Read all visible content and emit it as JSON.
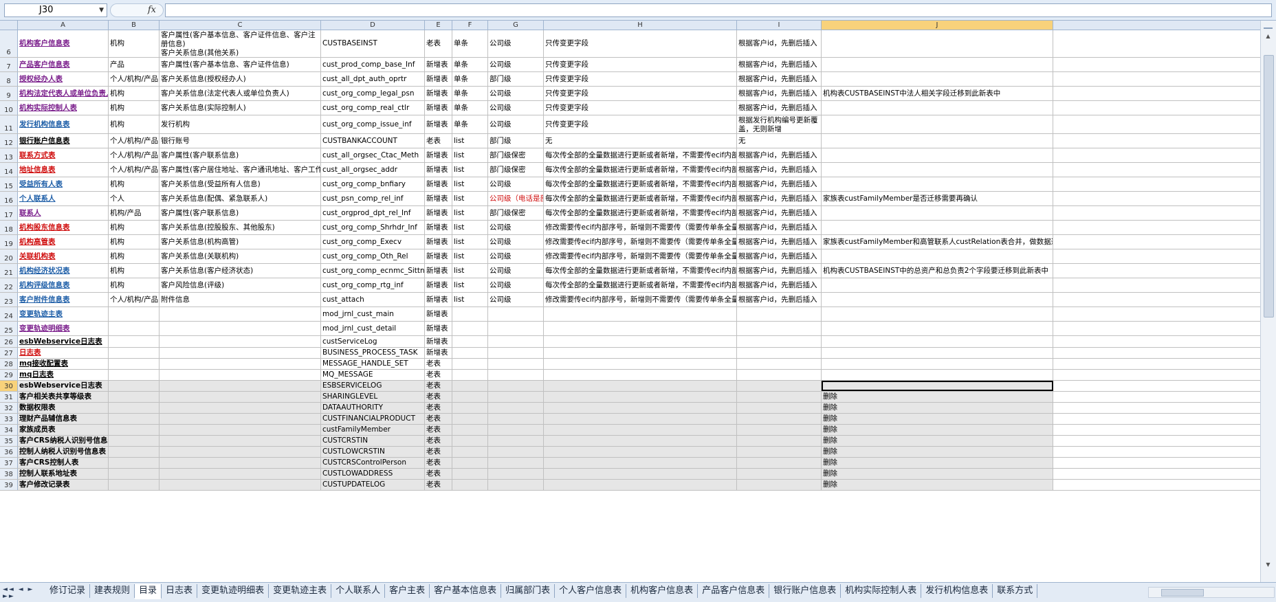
{
  "formula_bar": {
    "name_box": "J30",
    "fx": "fx",
    "formula": ""
  },
  "columns": [
    "A",
    "B",
    "C",
    "D",
    "E",
    "F",
    "G",
    "H",
    "I",
    "J"
  ],
  "selected_column": "J",
  "selected_row": "30",
  "rows": [
    {
      "n": "6",
      "a": "机构客户信息表",
      "as": "purple",
      "b": "机构",
      "c": "客户属性(客户基本信息、客户证件信息、客户注册信息)\n客户关系信息(其他关系)\n客户管理信息（客户标识信息）",
      "d": "CUSTBASEINST",
      "e": "老表",
      "f": "单条",
      "g": "公司级",
      "h": "只传变更字段",
      "i": "根据客户id，先删后插入",
      "j": ""
    },
    {
      "n": "7",
      "a": "产品客户信息表",
      "as": "purple",
      "b": "产品",
      "c": "客户属性(客户基本信息、客户证件信息)",
      "d": "cust_prod_comp_base_Inf",
      "e": "新增表",
      "f": "单条",
      "g": "公司级",
      "h": "只传变更字段",
      "i": "根据客户id，先删后插入",
      "j": ""
    },
    {
      "n": "8",
      "a": "授权经办人表",
      "as": "purple",
      "b": "个人/机构/产品",
      "c": "客户关系信息(授权经办人)",
      "d": "cust_all_dpt_auth_oprtr",
      "e": "新增表",
      "f": "单条",
      "g": "部门级",
      "h": "只传变更字段",
      "i": "根据客户id，先删后插入",
      "j": ""
    },
    {
      "n": "9",
      "a": "机构法定代表人或单位负责人表",
      "as": "purple",
      "b": "机构",
      "c": "客户关系信息(法定代表人或单位负责人)",
      "d": "cust_org_comp_legal_psn",
      "e": "新增表",
      "f": "单条",
      "g": "公司级",
      "h": "只传变更字段",
      "i": "根据客户id，先删后插入",
      "j": "机构表CUSTBASEINST中法人相关字段迁移到此新表中"
    },
    {
      "n": "10",
      "a": "机构实际控制人表",
      "as": "purple",
      "b": "机构",
      "c": "客户关系信息(实际控制人)",
      "d": "cust_org_comp_real_ctlr",
      "e": "新增表",
      "f": "单条",
      "g": "公司级",
      "h": "只传变更字段",
      "i": "根据客户id，先删后插入",
      "j": ""
    },
    {
      "n": "11",
      "a": "发行机构信息表",
      "as": "blue",
      "b": "机构",
      "c": "发行机构",
      "d": "cust_org_comp_issue_inf",
      "e": "新增表",
      "f": "单条",
      "g": "公司级",
      "h": "只传变更字段",
      "i": "根据发行机构编号更新覆盖，无则新增",
      "j": ""
    },
    {
      "n": "12",
      "a": "银行账户信息表",
      "as": "black",
      "b": "个人/机构/产品",
      "c": "银行账号",
      "d": "CUSTBANKACCOUNT",
      "e": "老表",
      "f": "list",
      "g": "部门级",
      "h": "无",
      "i": "无",
      "j": ""
    },
    {
      "n": "13",
      "a": "联系方式表",
      "as": "red",
      "b": "个人/机构/产品",
      "c": "客户属性(客户联系信息)",
      "d": "cust_all_orgsec_Ctac_Meth",
      "e": "新增表",
      "f": "list",
      "g": "部门级保密",
      "h": "每次传全部的全量数据进行更新或者新增，不需要传ecif内部序号",
      "i": "根据客户id，先删后插入",
      "j": ""
    },
    {
      "n": "14",
      "a": "地址信息表",
      "as": "red",
      "b": "个人/机构/产品",
      "c": "客户属性(客户居住地址、客户通讯地址、客户工作地址)",
      "d": "cust_all_orgsec_addr",
      "e": "新增表",
      "f": "list",
      "g": "部门级保密",
      "h": "每次传全部的全量数据进行更新或者新增，不需要传ecif内部序号",
      "i": "根据客户id，先删后插入",
      "j": ""
    },
    {
      "n": "15",
      "a": "受益所有人表",
      "as": "blue",
      "b": "机构",
      "c": "客户关系信息(受益所有人信息)",
      "d": "cust_org_comp_bnfiary",
      "e": "新增表",
      "f": "list",
      "g": "公司级",
      "h": "每次传全部的全量数据进行更新或者新增，不需要传ecif内部序号",
      "i": "根据客户id，先删后插入",
      "j": ""
    },
    {
      "n": "16",
      "a": "个人联系人",
      "as": "blue",
      "b": "个人",
      "c": "客户关系信息(配偶、紧急联系人)",
      "d": "cust_psn_comp_rel_inf",
      "e": "新增表",
      "f": "list",
      "g": "公司级（电话是部",
      "gr": true,
      "h": "每次传全部的全量数据进行更新或者新增，不需要传ecif内部序号",
      "i": "根据客户id，先删后插入",
      "j": "家族表custFamilyMember是否迁移需要再确认"
    },
    {
      "n": "17",
      "a": "联系人",
      "as": "purple",
      "b": "机构/产品",
      "c": "客户属性(客户联系信息)",
      "d": "cust_orgprod_dpt_rel_Inf",
      "e": "新增表",
      "f": "list",
      "g": "部门级保密",
      "h": "每次传全部的全量数据进行更新或者新增，不需要传ecif内部序号",
      "i": "根据客户id，先删后插入",
      "j": ""
    },
    {
      "n": "18",
      "a": "机构股东信息表",
      "as": "red",
      "b": "机构",
      "c": "客户关系信息(控股股东、其他股东)",
      "d": "cust_org_comp_Shrhdr_Inf",
      "e": "新增表",
      "f": "list",
      "g": "公司级",
      "h": "修改需要传ecif内部序号，新增则不需要传（需要传单条全量）",
      "i": "根据客户id，先删后插入",
      "j": ""
    },
    {
      "n": "19",
      "a": "机构高管表",
      "as": "red",
      "b": "机构",
      "c": "客户关系信息(机构高管)",
      "d": "cust_org_comp_Execv",
      "e": "新增表",
      "f": "list",
      "g": "公司级",
      "h": "修改需要传ecif内部序号，新增则不需要传（需要传单条全量）",
      "i": "根据客户id，先删后插入",
      "j": "家族表custFamilyMember和高管联系人custRelation表合并，做数据迁移"
    },
    {
      "n": "20",
      "a": "关联机构表",
      "as": "red",
      "b": "机构",
      "c": "客户关系信息(关联机构)",
      "d": "cust_org_comp_Oth_Rel",
      "e": "新增表",
      "f": "list",
      "g": "公司级",
      "h": "修改需要传ecif内部序号，新增则不需要传（需要传单条全量）",
      "i": "根据客户id，先删后插入",
      "j": ""
    },
    {
      "n": "21",
      "a": "机构经济状况表",
      "as": "blue",
      "b": "机构",
      "c": "客户关系信息(客户经济状态)",
      "d": "cust_org_comp_ecnmc_Sittn",
      "e": "新增表",
      "f": "list",
      "g": "公司级",
      "h": "每次传全部的全量数据进行更新或者新增，不需要传ecif内部序号",
      "i": "根据客户id，先删后插入",
      "j": "机构表CUSTBASEINST中的总资产和总负责2个字段要迁移到此新表中"
    },
    {
      "n": "22",
      "a": "机构评级信息表",
      "as": "blue",
      "b": "机构",
      "c": "客户风险信息(评级)",
      "d": "cust_org_comp_rtg_inf",
      "e": "新增表",
      "f": "list",
      "g": "公司级",
      "h": "每次传全部的全量数据进行更新或者新增，不需要传ecif内部序号",
      "i": "根据客户id，先删后插入",
      "j": ""
    },
    {
      "n": "23",
      "a": "客户附件信息表",
      "as": "blue",
      "b": "个人/机构/产品",
      "c": "附件信息",
      "d": "cust_attach",
      "e": "新增表",
      "f": "list",
      "g": "公司级",
      "h": "修改需要传ecif内部序号，新增则不需要传（需要传单条全量）",
      "i": "根据客户id，先删后插入",
      "j": ""
    },
    {
      "n": "24",
      "a": "变更轨迹主表",
      "as": "blue",
      "b": "",
      "c": "",
      "d": "mod_jrnl_cust_main",
      "e": "新增表",
      "f": "",
      "g": "",
      "h": "",
      "i": "",
      "j": ""
    },
    {
      "n": "25",
      "a": "变更轨迹明细表",
      "as": "purple",
      "b": "",
      "c": "",
      "d": "mod_jrnl_cust_detail",
      "e": "新增表",
      "f": "",
      "g": "",
      "h": "",
      "i": "",
      "j": ""
    },
    {
      "n": "26",
      "a": "esbWebservice日志表",
      "as": "black",
      "b": "",
      "c": "",
      "d": "custServiceLog",
      "e": "新增表",
      "f": "",
      "g": "",
      "h": "",
      "i": "",
      "j": ""
    },
    {
      "n": "27",
      "a": "日志表",
      "as": "red",
      "b": "",
      "c": "",
      "d": "BUSINESS_PROCESS_TASK",
      "e": "新增表",
      "f": "",
      "g": "",
      "h": "",
      "i": "",
      "j": ""
    },
    {
      "n": "28",
      "a": "mq接收配置表",
      "as": "black",
      "b": "",
      "c": "",
      "d": "MESSAGE_HANDLE_SET",
      "e": "老表",
      "f": "",
      "g": "",
      "h": "",
      "i": "",
      "j": ""
    },
    {
      "n": "29",
      "a": "mq日志表",
      "as": "black",
      "b": "",
      "c": "",
      "d": "MQ_MESSAGE",
      "e": "老表",
      "f": "",
      "g": "",
      "h": "",
      "i": "",
      "j": ""
    },
    {
      "n": "30",
      "a": "esbWebservice日志表",
      "as": "plain",
      "b": "",
      "c": "",
      "d": "ESBSERVICELOG",
      "e": "老表",
      "f": "",
      "g": "",
      "h": "",
      "i": "",
      "j": "",
      "gray": true
    },
    {
      "n": "31",
      "a": "客户相关表共享等级表",
      "as": "plain",
      "b": "",
      "c": "",
      "d": "SHARINGLEVEL",
      "e": "老表",
      "f": "",
      "g": "",
      "h": "",
      "i": "",
      "j": "删除",
      "gray": true
    },
    {
      "n": "32",
      "a": "数据权限表",
      "as": "plain",
      "b": "",
      "c": "",
      "d": "DATAAUTHORITY",
      "e": "老表",
      "f": "",
      "g": "",
      "h": "",
      "i": "",
      "j": "删除",
      "gray": true
    },
    {
      "n": "33",
      "a": "理财产品辅信息表",
      "as": "plain",
      "b": "",
      "c": "",
      "d": "CUSTFINANCIALPRODUCT",
      "e": "老表",
      "f": "",
      "g": "",
      "h": "",
      "i": "",
      "j": "删除",
      "gray": true
    },
    {
      "n": "34",
      "a": "家族成员表",
      "as": "plain",
      "b": "",
      "c": "",
      "d": "custFamilyMember",
      "e": "老表",
      "f": "",
      "g": "",
      "h": "",
      "i": "",
      "j": "删除",
      "gray": true
    },
    {
      "n": "35",
      "a": "客户CRS纳税人识别号信息表",
      "as": "plain",
      "b": "",
      "c": "",
      "d": "CUSTCRSTIN",
      "e": "老表",
      "f": "",
      "g": "",
      "h": "",
      "i": "",
      "j": "删除",
      "gray": true
    },
    {
      "n": "36",
      "a": "控制人纳税人识别号信息表",
      "as": "plain",
      "b": "",
      "c": "",
      "d": "CUSTLOWCRSTIN",
      "e": "老表",
      "f": "",
      "g": "",
      "h": "",
      "i": "",
      "j": "删除",
      "gray": true
    },
    {
      "n": "37",
      "a": "客户CRS控制人表",
      "as": "plain",
      "b": "",
      "c": "",
      "d": "CUSTCRSControlPerson",
      "e": "老表",
      "f": "",
      "g": "",
      "h": "",
      "i": "",
      "j": "删除",
      "gray": true
    },
    {
      "n": "38",
      "a": "控制人联系地址表",
      "as": "plain",
      "b": "",
      "c": "",
      "d": "CUSTLOWADDRESS",
      "e": "老表",
      "f": "",
      "g": "",
      "h": "",
      "i": "",
      "j": "删除",
      "gray": true
    },
    {
      "n": "39",
      "a": "客户修改记录表",
      "as": "plain",
      "b": "",
      "c": "",
      "d": "CUSTUPDATELOG",
      "e": "老表",
      "f": "",
      "g": "",
      "h": "",
      "i": "",
      "j": "删除",
      "gray": true
    }
  ],
  "sheet_tabs": [
    "修订记录",
    "建表规则",
    "目录",
    "日志表",
    "变更轨迹明细表",
    "变更轨迹主表",
    "个人联系人",
    "客户主表",
    "客户基本信息表",
    "归属部门表",
    "个人客户信息表",
    "机构客户信息表",
    "产品客户信息表",
    "银行账户信息表",
    "机构实际控制人表",
    "发行机构信息表",
    "联系方式"
  ],
  "active_tab": "目录",
  "icons": {
    "tab_nav": "sheet-nav-arrows-icon",
    "scroll": "scroll-arrow-icon"
  }
}
